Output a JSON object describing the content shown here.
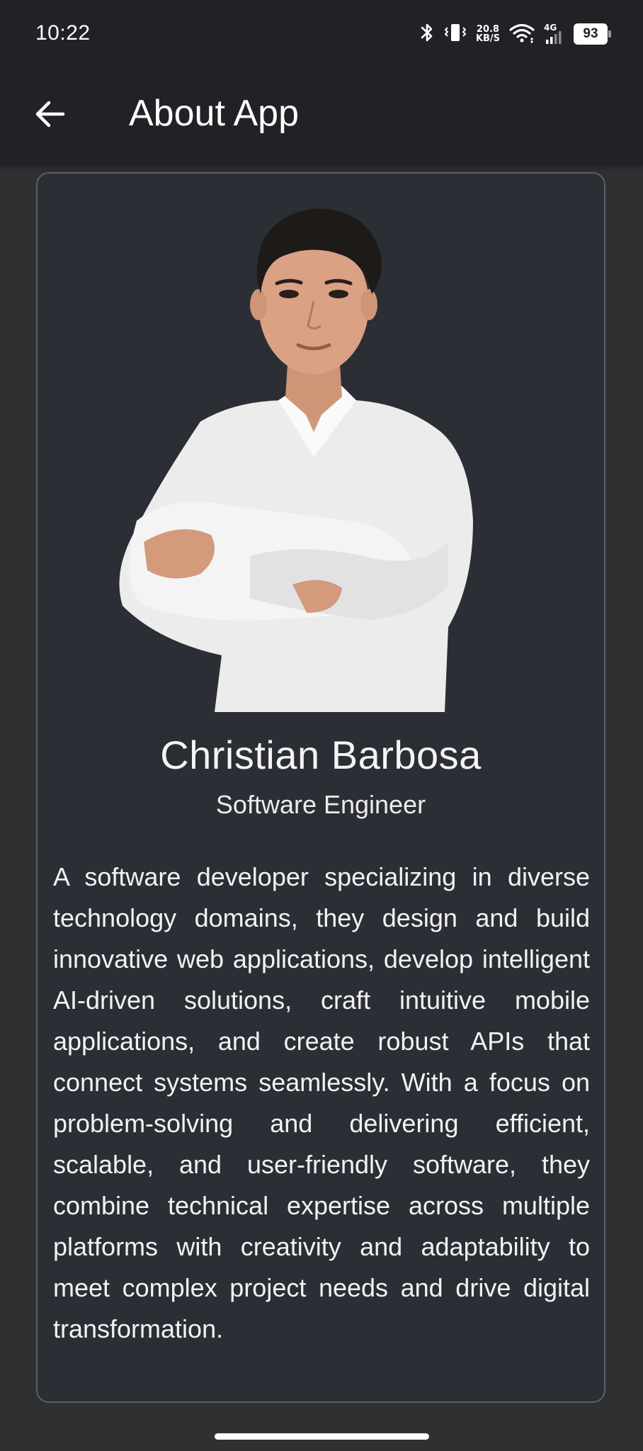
{
  "status_bar": {
    "time": "10:22",
    "net_speed_value": "20.8",
    "net_speed_unit": "KB/S",
    "network_type": "4G",
    "battery_level": "93",
    "icons": [
      "bluetooth-icon",
      "vibrate-icon",
      "wifi-icon",
      "cellular-signal-icon",
      "battery-icon"
    ]
  },
  "app_bar": {
    "title": "About App",
    "back_icon": "arrow-left-icon"
  },
  "profile": {
    "name": "Christian Barbosa",
    "role": "Software Engineer",
    "bio": "A software developer specializing in diverse technology domains, they design and build innovative web applications, develop intelligent AI-driven solutions, craft intuitive mobile applications, and create robust APIs that connect systems seamlessly. With a focus on problem-solving and delivering efficient, scalable, and user-friendly software, they combine technical expertise across multiple platforms with creativity and adaptability to meet complex project needs and drive digital transformation."
  },
  "colors": {
    "app_bar_bg": "#222226",
    "page_bg": "#2f3032",
    "card_bg": "#2b2e35",
    "card_border": "#5c5f66",
    "text": "#f2f2f2"
  }
}
